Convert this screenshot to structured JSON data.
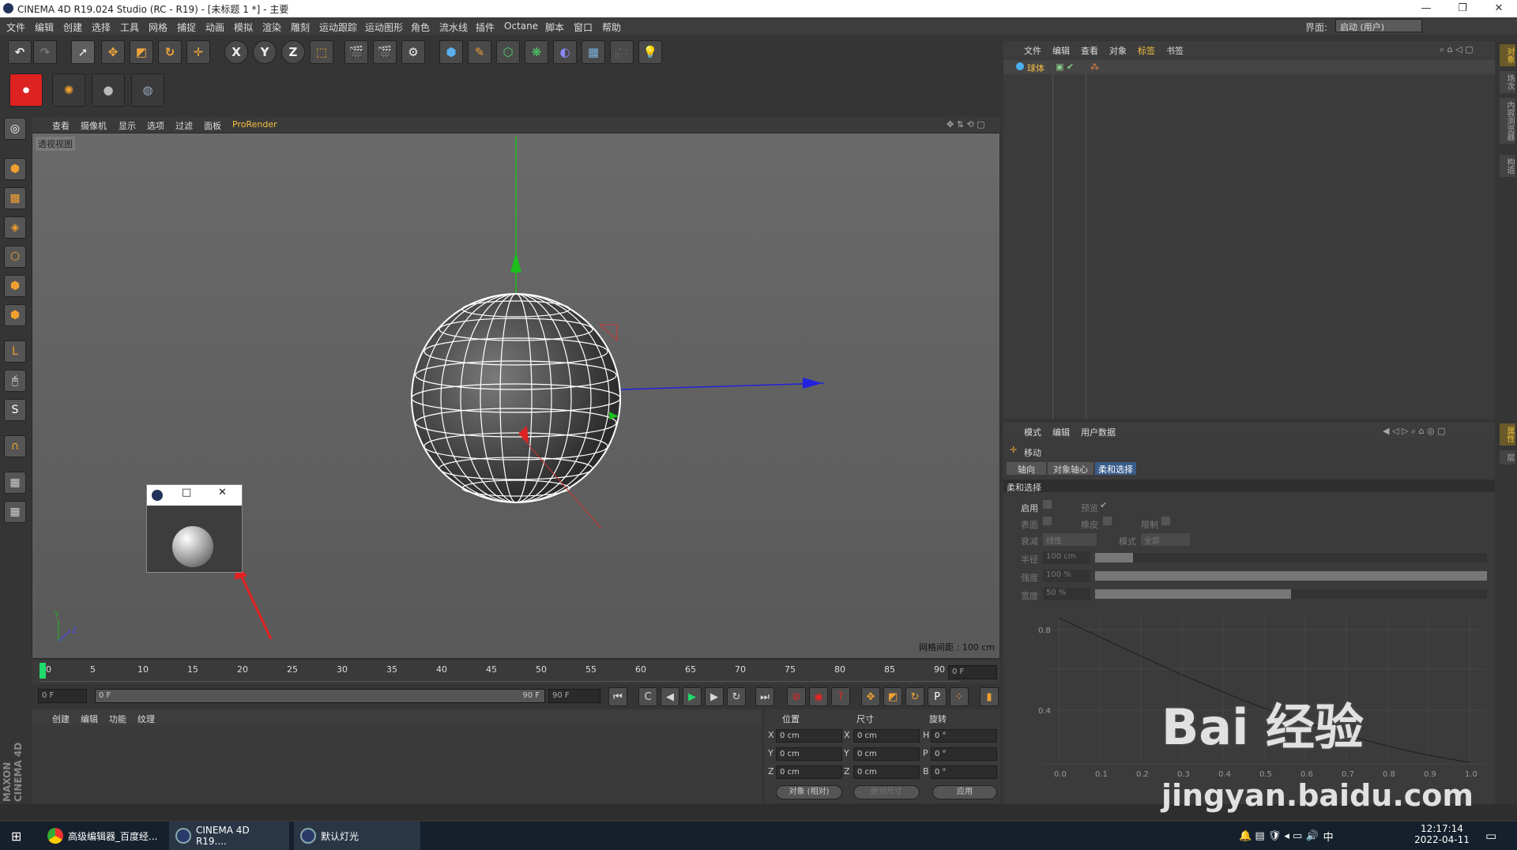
{
  "titlebar": {
    "title": "CINEMA 4D R19.024 Studio (RC - R19) - [未标题 1 *] - 主要",
    "min": "—",
    "max": "❐",
    "close": "✕"
  },
  "menu": [
    "文件",
    "编辑",
    "创建",
    "选择",
    "工具",
    "网格",
    "捕捉",
    "动画",
    "模拟",
    "渲染",
    "雕刻",
    "运动跟踪",
    "运动图形",
    "角色",
    "流水线",
    "插件",
    "Octane",
    "脚本",
    "窗口",
    "帮助"
  ],
  "layout": {
    "label": "界面:",
    "value": "启动 (用户)"
  },
  "viewport": {
    "menu": [
      "查看",
      "摄像机",
      "显示",
      "选项",
      "过滤",
      "面板",
      "ProRender"
    ],
    "label": "透视视图",
    "grid": "网格间距 : 100 cm"
  },
  "timeline": {
    "ticks": [
      "0",
      "5",
      "10",
      "15",
      "20",
      "25",
      "30",
      "35",
      "40",
      "45",
      "50",
      "55",
      "60",
      "65",
      "70",
      "75",
      "80",
      "85",
      "90"
    ],
    "end": "0 F"
  },
  "transport": {
    "start": "0 F",
    "range_start": "0 F",
    "range_end": "90 F",
    "end": "90 F"
  },
  "material": {
    "menu": [
      "创建",
      "编辑",
      "功能",
      "纹理"
    ]
  },
  "coords": {
    "headers": [
      "位置",
      "尺寸",
      "旋转"
    ],
    "pos": [
      "0 cm",
      "0 cm",
      "0 cm"
    ],
    "size": [
      "0 cm",
      "0 cm",
      "0 cm"
    ],
    "rot": [
      "0 °",
      "0 °",
      "0 °"
    ],
    "axes": [
      "X",
      "Y",
      "Z"
    ],
    "rotaxes": [
      "H",
      "P",
      "B"
    ],
    "mode": "对象 (相对)",
    "sizemode": "绝对尺寸",
    "apply": "应用"
  },
  "objmgr": {
    "menu": [
      "文件",
      "编辑",
      "查看",
      "对象",
      "标签",
      "书签"
    ],
    "object": "球体"
  },
  "attr": {
    "menu": [
      "模式",
      "编辑",
      "用户数据"
    ],
    "tool": "移动",
    "tabs": [
      "轴向",
      "对象轴心",
      "柔和选择"
    ],
    "section": "柔和选择",
    "rows": [
      "启用",
      "预览",
      "表面",
      "橡皮",
      "限制",
      "衰减",
      "线性",
      "模式",
      "全部",
      "半径",
      "100 cm",
      "强度",
      "100 %",
      "宽度",
      "50 %"
    ],
    "graph_y": [
      "0.8",
      "0.4"
    ],
    "graph_x": [
      "0.0",
      "0.1",
      "0.2",
      "0.3",
      "0.4",
      "0.5",
      "0.6",
      "0.7",
      "0.8",
      "0.9",
      "1.0"
    ]
  },
  "right_tabs": [
    "对象",
    "场次",
    "内容浏览器",
    "构造",
    "属性",
    "层"
  ],
  "taskbar": {
    "items": [
      "高级编辑器_百度经...",
      "CINEMA 4D R19....",
      "默认灯光"
    ],
    "time": "12:17:14",
    "date": "2022-04-11",
    "ime": "中"
  },
  "watermark": {
    "main": "Bai 经验",
    "sub": "jingyan.baidu.com"
  },
  "brand": "MAXON CINEMA 4D"
}
